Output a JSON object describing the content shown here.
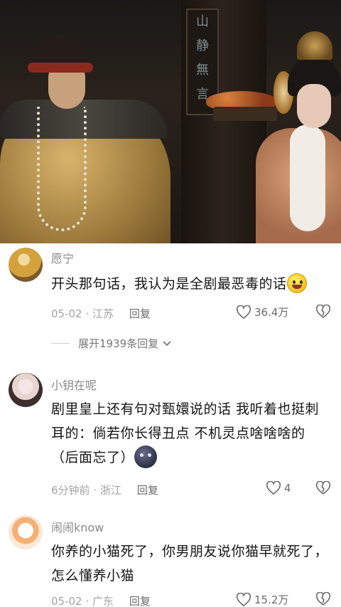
{
  "video": {
    "plaque_chars": [
      "山",
      "静",
      "無",
      "言"
    ]
  },
  "comments": [
    {
      "username": "愿宁",
      "text": "开头那句话，我认为是全剧最恶毒的话",
      "emoji": "grinning-face-emoji",
      "date_location": "05-02 · 江苏",
      "reply_label": "回复",
      "likes": "36.4万"
    },
    {
      "username": "小钥在呢",
      "text": "剧里皇上还有句对甄嬛说的话 我听着也挺刺耳的：倘若你长得丑点 不机灵点啥啥啥的（后面忘了）",
      "emoji": "dark-face-emoji",
      "date_location": "6分钟前 · 浙江",
      "reply_label": "回复",
      "likes": "4"
    },
    {
      "username": "闹闹know",
      "text": "你养的小猫死了，你男朋友说你猫早就死了，怎么懂养小猫",
      "date_location": "05-02 · 广东",
      "reply_label": "回复",
      "likes": "15.2万"
    }
  ],
  "expand_replies": "展开1939条回复"
}
